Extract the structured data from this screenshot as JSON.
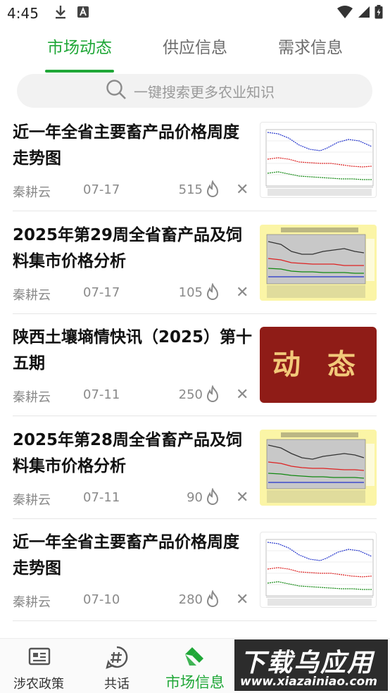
{
  "status_bar": {
    "time": "4:45"
  },
  "tabs": [
    {
      "label": "市场动态",
      "active": true
    },
    {
      "label": "供应信息",
      "active": false
    },
    {
      "label": "需求信息",
      "active": false
    }
  ],
  "search": {
    "placeholder": "一键搜索更多农业知识"
  },
  "articles": [
    {
      "title": "近一年全省主要畜产品价格周度走势图",
      "source": "秦耕云",
      "date": "07-17",
      "views": "515",
      "thumb": "price-chart-white"
    },
    {
      "title": "2025年第29周全省畜产品及饲料集市价格分析",
      "source": "秦耕云",
      "date": "07-17",
      "views": "105",
      "thumb": "price-chart-yellow"
    },
    {
      "title": "陕西土壤墒情快讯（2025）第十五期",
      "source": "秦耕云",
      "date": "07-11",
      "views": "250",
      "thumb": "dongtai-banner",
      "thumb_text": "动 态"
    },
    {
      "title": "2025年第28周全省畜产品及饲料集市价格分析",
      "source": "秦耕云",
      "date": "07-11",
      "views": "90",
      "thumb": "price-chart-yellow"
    },
    {
      "title": "近一年全省主要畜产品价格周度走势图",
      "source": "秦耕云",
      "date": "07-10",
      "views": "280",
      "thumb": "price-chart-white"
    }
  ],
  "bottom_nav": [
    {
      "label": "涉农政策",
      "icon": "policy-icon",
      "active": false
    },
    {
      "label": "共话",
      "icon": "hashtag-icon",
      "active": false
    },
    {
      "label": "市场信息",
      "icon": "market-icon",
      "active": true
    }
  ],
  "watermark": {
    "title": "下载乌应用",
    "url": "www.xiazainiao.com"
  },
  "colors": {
    "accent": "#1fa737",
    "banner": "#8f1c17",
    "banner_text": "#f2c97a",
    "chart_yellow": "#fbf5a6"
  }
}
